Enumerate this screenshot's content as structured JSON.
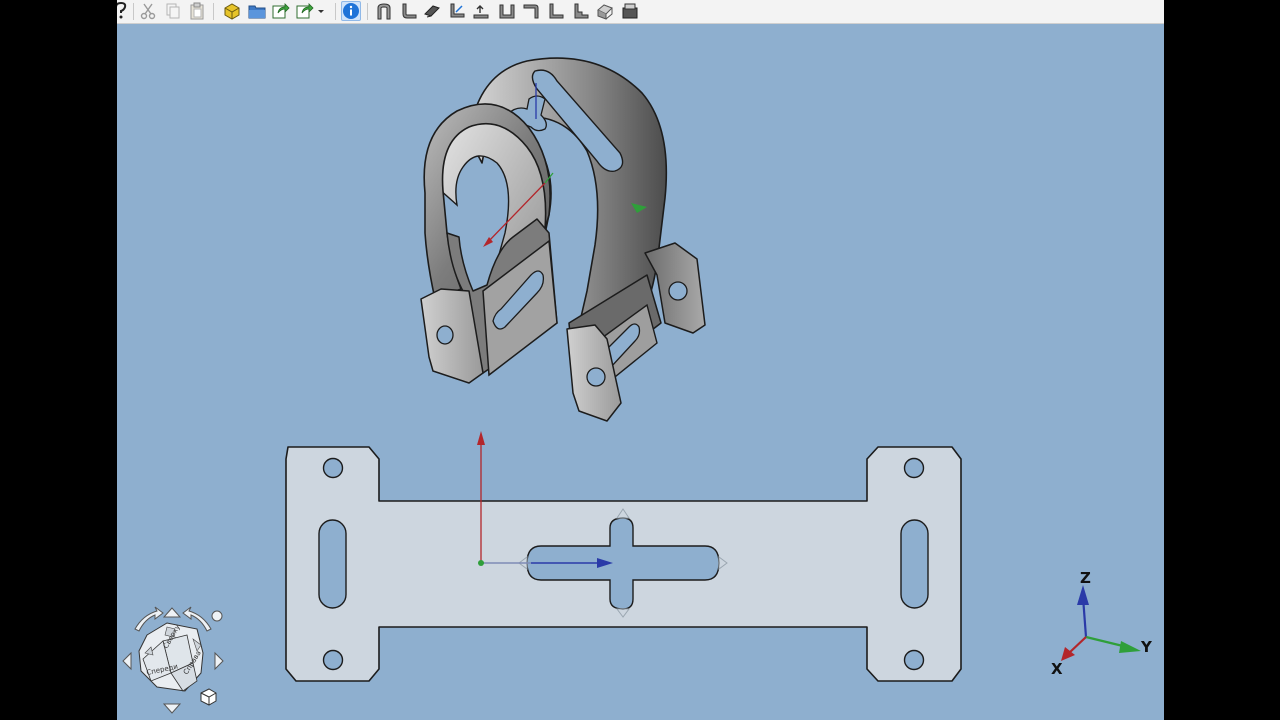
{
  "toolbar": {
    "items": [
      {
        "id": "help",
        "icon": "whats-this-icon"
      },
      {
        "id": "cut",
        "icon": "cut-icon"
      },
      {
        "id": "copy",
        "icon": "copy-icon"
      },
      {
        "id": "paste",
        "icon": "paste-icon"
      },
      {
        "id": "part",
        "icon": "part-icon"
      },
      {
        "id": "open",
        "icon": "folder-icon"
      },
      {
        "id": "export",
        "icon": "export-icon"
      },
      {
        "id": "share",
        "icon": "share-icon"
      },
      {
        "id": "info",
        "icon": "info-icon",
        "active": true
      },
      {
        "id": "sm-base-bend",
        "icon": "sheetmetal-base-bend-icon"
      },
      {
        "id": "sm-wall",
        "icon": "sheetmetal-wall-icon"
      },
      {
        "id": "sm-extend",
        "icon": "sheetmetal-extend-icon"
      },
      {
        "id": "sm-fold",
        "icon": "sheetmetal-fold-icon"
      },
      {
        "id": "sm-unfold",
        "icon": "sheetmetal-unfold-icon"
      },
      {
        "id": "sm-corner-relief",
        "icon": "sheetmetal-corner-relief-icon"
      },
      {
        "id": "sm-jog",
        "icon": "sheetmetal-jog-icon"
      },
      {
        "id": "sm-bend",
        "icon": "sheetmetal-bend-icon"
      },
      {
        "id": "sm-form",
        "icon": "sheetmetal-form-icon"
      },
      {
        "id": "sm-solid",
        "icon": "sheetmetal-solid-icon"
      },
      {
        "id": "sm-sketch",
        "icon": "sheetmetal-sketch-unfold-icon"
      }
    ]
  },
  "navigation_cube": {
    "faces": [
      "Спереди",
      "Сверху",
      "Справа"
    ]
  },
  "axis_cross": {
    "x": "X",
    "y": "Y",
    "z": "Z",
    "colors": {
      "x": "#b3262b",
      "y": "#2f9f3a",
      "z": "#2a3aa8"
    }
  },
  "colors": {
    "viewport_background": "#8eafcf",
    "flat_pattern_fill": "#cdd6df",
    "bracket_dark": "#5e5e5e",
    "bracket_light": "#d2d2d2"
  }
}
